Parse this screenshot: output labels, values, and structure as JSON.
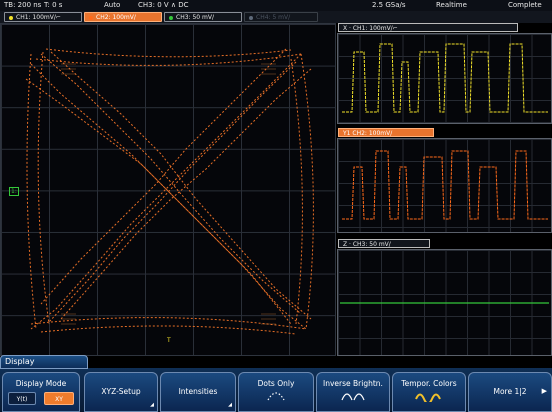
{
  "status": {
    "timebase": "TB: 200 ns",
    "trigger_time": "T: 0 s",
    "mode": "Auto",
    "trigger_info": "CH3: 0 V ∧ DC",
    "sample_rate": "2.5 GSa/s",
    "acq_mode": "Realtime",
    "acq_status": "Complete"
  },
  "channel_tabs": [
    {
      "label": "CH1: 100mV/⌐",
      "color": "#f2e22a"
    },
    {
      "label": "CH2: 100mV/",
      "color": "#ff6a1a"
    },
    {
      "label": "CH3: 50 mV/",
      "color": "#35c83a"
    },
    {
      "label": "CH4: 5 mV/",
      "color": "#5e6a7a"
    }
  ],
  "marker_label": "1:",
  "marker_bottom": "T",
  "panels": {
    "x": {
      "title": "X · CH1: 100mV/⌐",
      "color": "#f2e22a"
    },
    "y": {
      "title": "Y1  CH2: 100mV/",
      "color": "#ff6a1a"
    },
    "z": {
      "title": "Z · CH3: 50 mV/",
      "color": "#35c83a"
    }
  },
  "menu": {
    "title": "Display",
    "display_mode_label": "Display Mode",
    "display_mode_options": [
      "Y(t)",
      "XY"
    ],
    "display_mode_selected": "XY",
    "softkeys": [
      "XYZ-Setup",
      "Intensities",
      "Dots Only",
      "Inverse Brightn.",
      "Tempor. Colors",
      "More 1|2"
    ]
  }
}
